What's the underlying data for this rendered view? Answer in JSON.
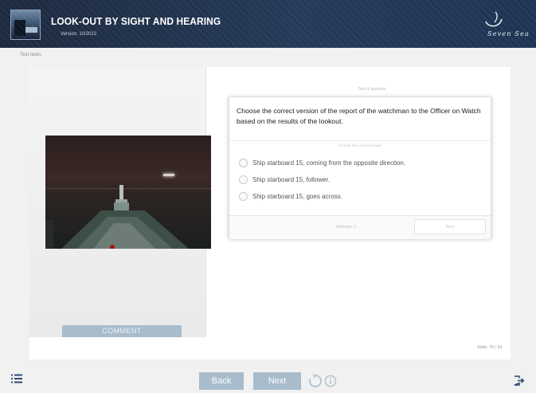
{
  "header": {
    "title": "LOOK-OUT BY SIGHT AND HEARING",
    "version": "Version: 10/2022",
    "brand": "Seven Sea",
    "logo_icon": "ship-bridge-thumbnail",
    "brand_icon": "brand-swoosh-icon"
  },
  "breadcrumb": "Test tasks",
  "task": {
    "image_icon": "night-sea-view-from-bow",
    "comment_label": "COMMENT",
    "question_caption": "Text of question",
    "question": "Choose the correct version of the report of the watchman to the Officer on Watch based on the results of the lookout.",
    "answer_caption": "Choose the correct answer",
    "options": [
      {
        "label": "Ship starboard 15, coming from the opposite direction.",
        "selected": false
      },
      {
        "label": "Ship starboard 15, follower.",
        "selected": false
      },
      {
        "label": "Ship starboard 15, goes across.",
        "selected": false
      }
    ],
    "attempts": "Attempts: 1",
    "next_field": "Next"
  },
  "slide_counter": "Slide: 70 / 91",
  "footer": {
    "back_label": "Back",
    "next_label": "Next",
    "menu_icon": "list-menu-icon",
    "reload_icon": "reload-icon",
    "info_icon": "info-icon",
    "exit_icon": "exit-icon"
  },
  "colors": {
    "header_bg": "#1f3454",
    "button_bg": "#a8bccb",
    "page_bg": "#f1f1f1",
    "icon_color": "#2b4a75"
  }
}
